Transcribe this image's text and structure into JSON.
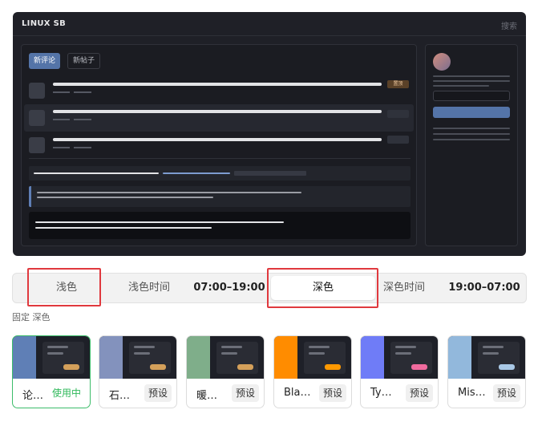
{
  "preview": {
    "logo": "LINUX SB",
    "search": "搜索",
    "tabs": [
      "新评论",
      "新帖子"
    ],
    "badge": "置顶"
  },
  "mode_bar": {
    "light": "浅色",
    "light_time_label": "浅色时间",
    "light_time": "07:00–19:00",
    "dark": "深色",
    "dark_time_label": "深色时间",
    "dark_time": "19:00–07:00",
    "active": "深色"
  },
  "fixed_label": "固定 深色",
  "themes": [
    {
      "name": "论…",
      "status": "使用中",
      "accent": "#5f7fb6",
      "tag": "#d4a05a",
      "selected": true
    },
    {
      "name": "石…",
      "status": "预设",
      "accent": "#8392bd",
      "tag": "#d4a05a"
    },
    {
      "name": "暖…",
      "status": "预设",
      "accent": "#7fae8a",
      "tag": "#d4a05a"
    },
    {
      "name": "Bla…",
      "status": "预设",
      "accent": "#ff8c00",
      "tag": "#ff9900"
    },
    {
      "name": "Ty…",
      "status": "预设",
      "accent": "#6f7cf7",
      "tag": "#f06b9e"
    },
    {
      "name": "Mis…",
      "status": "预设",
      "accent": "#92b8dc",
      "tag": "#a9c8e6"
    }
  ]
}
